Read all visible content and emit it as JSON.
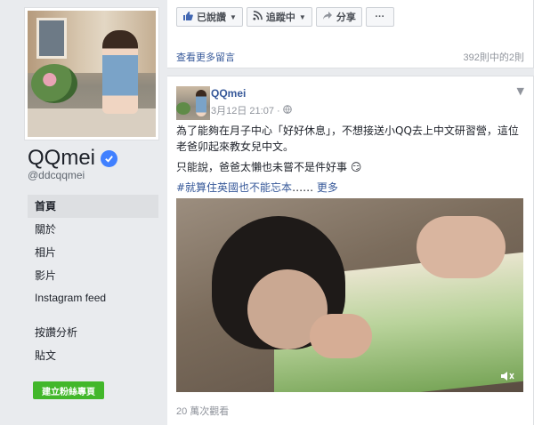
{
  "sidebar": {
    "page_name": "QQmei",
    "username": "@ddcqqmei",
    "nav": [
      {
        "label": "首頁",
        "active": true
      },
      {
        "label": "關於"
      },
      {
        "label": "相片"
      },
      {
        "label": "影片"
      },
      {
        "label": "Instagram feed"
      },
      {
        "label": "按讚分析"
      },
      {
        "label": "貼文"
      }
    ],
    "create_page_button": "建立粉絲專頁"
  },
  "top_card": {
    "like_label": "已說讚",
    "follow_label": "追蹤中",
    "share_label": "分享",
    "more_label": "···",
    "see_more_comments": "查看更多留言",
    "comment_count": "392則中的2則"
  },
  "post": {
    "author": "QQmei",
    "timestamp": "3月12日 21:07 · ",
    "text_line1": "為了能夠在月子中心「好好休息」，不想接送小QQ去上中文研習營，這位老爸卯起來教女兒中文。",
    "text_line2": "只能說，爸爸太懶也未嘗不是件好事 😏",
    "hashtag": "#就算住英國也不能忘本",
    "ellipsis": "……",
    "more": "更多",
    "views": "20 萬次觀看"
  },
  "colors": {
    "link": "#365899",
    "verified": "#4080ff",
    "create_button": "#42b72a",
    "page_bg": "#e9ebee"
  }
}
